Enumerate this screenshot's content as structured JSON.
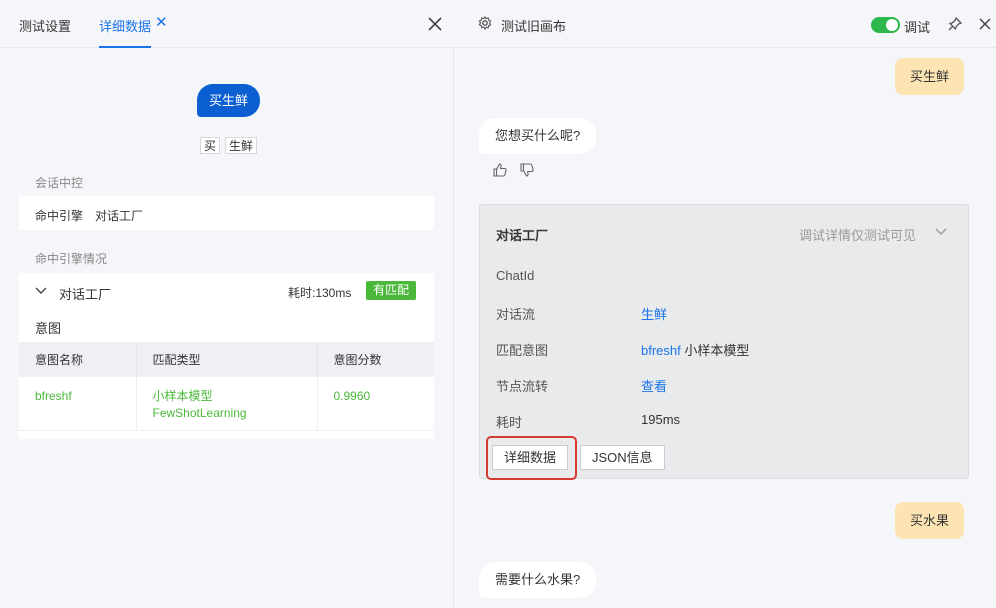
{
  "left": {
    "tabs": [
      {
        "label": "测试设置"
      },
      {
        "label": "详细数据"
      }
    ],
    "tab_close": "✕",
    "query": "买生鲜",
    "tokens": [
      "买",
      "生鲜"
    ],
    "section_session": "会话中控",
    "hit_engine_label": "命中引擎",
    "hit_engine_value": "对话工厂",
    "section_engine": "命中引擎情况",
    "engine": {
      "name": "对话工厂",
      "time": "耗时:130ms",
      "badge": "有匹配",
      "intent_title": "意图",
      "columns": [
        "意图名称",
        "匹配类型",
        "意图分数"
      ],
      "rows": [
        {
          "name": "bfreshf",
          "type": "小样本模型",
          "type_sub": "FewShotLearning",
          "score": "0.9960"
        }
      ]
    }
  },
  "right": {
    "title": "测试旧画布",
    "debug_label": "调试",
    "messages": {
      "user1": "买生鲜",
      "bot1": "您想买什么呢?",
      "user2": "买水果",
      "bot2": "需要什么水果?"
    },
    "card": {
      "title": "对话工厂",
      "note": "调试详情仅测试可见",
      "rows": [
        {
          "label": "ChatId",
          "value": ""
        },
        {
          "label": "对话流",
          "value": "生鲜"
        },
        {
          "label": "匹配意图",
          "value": "bfreshf",
          "extra": "小样本模型"
        },
        {
          "label": "节点流转",
          "value": "查看"
        },
        {
          "label": "耗时",
          "value": "195ms"
        }
      ],
      "buttons": {
        "detail": "详细数据",
        "json": "JSON信息"
      }
    }
  },
  "colors": {
    "accent": "#1a73e8",
    "user_bubble": "#fde5b3",
    "match_green": "#4cb83b",
    "highlight": "#d63b2f"
  }
}
